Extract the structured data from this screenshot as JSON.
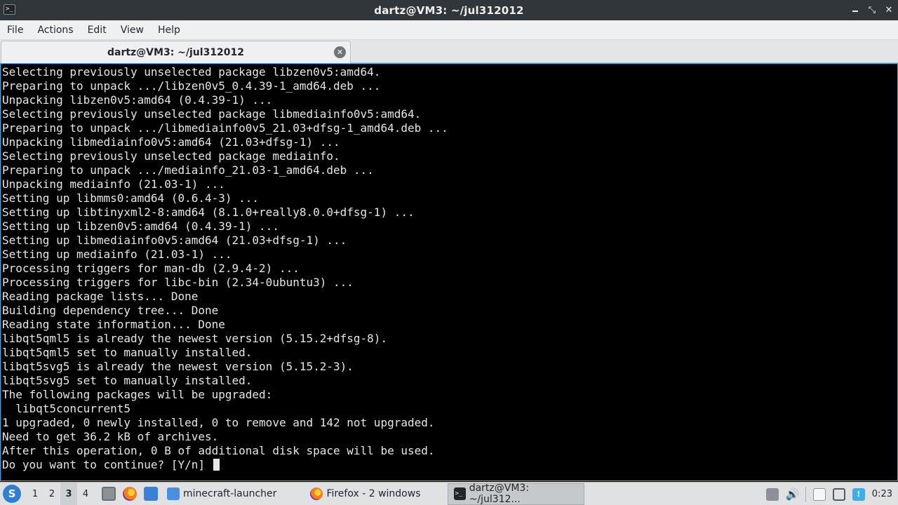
{
  "window": {
    "title": "dartz@VM3: ~/jul312012",
    "controls": [
      "minimize",
      "restore",
      "close"
    ]
  },
  "menu": {
    "items": [
      "File",
      "Actions",
      "Edit",
      "View",
      "Help"
    ]
  },
  "tab": {
    "label": "dartz@VM3: ~/jul312012"
  },
  "terminal": {
    "lines": [
      "Selecting previously unselected package libzen0v5:amd64.",
      "Preparing to unpack .../libzen0v5_0.4.39-1_amd64.deb ...",
      "Unpacking libzen0v5:amd64 (0.4.39-1) ...",
      "Selecting previously unselected package libmediainfo0v5:amd64.",
      "Preparing to unpack .../libmediainfo0v5_21.03+dfsg-1_amd64.deb ...",
      "Unpacking libmediainfo0v5:amd64 (21.03+dfsg-1) ...",
      "Selecting previously unselected package mediainfo.",
      "Preparing to unpack .../mediainfo_21.03-1_amd64.deb ...",
      "Unpacking mediainfo (21.03-1) ...",
      "Setting up libmms0:amd64 (0.6.4-3) ...",
      "Setting up libtinyxml2-8:amd64 (8.1.0+really8.0.0+dfsg-1) ...",
      "Setting up libzen0v5:amd64 (0.4.39-1) ...",
      "Setting up libmediainfo0v5:amd64 (21.03+dfsg-1) ...",
      "Setting up mediainfo (21.03-1) ...",
      "Processing triggers for man-db (2.9.4-2) ...",
      "Processing triggers for libc-bin (2.34-0ubuntu3) ...",
      "Reading package lists... Done",
      "Building dependency tree... Done",
      "Reading state information... Done",
      "libqt5qml5 is already the newest version (5.15.2+dfsg-8).",
      "libqt5qml5 set to manually installed.",
      "libqt5svg5 is already the newest version (5.15.2-3).",
      "libqt5svg5 set to manually installed.",
      "The following packages will be upgraded:",
      "  libqt5concurrent5",
      "1 upgraded, 0 newly installed, 0 to remove and 142 not upgraded.",
      "Need to get 36.2 kB of archives.",
      "After this operation, 0 B of additional disk space will be used.",
      "Do you want to continue? [Y/n] "
    ]
  },
  "taskbar": {
    "workspaces": [
      "1",
      "2",
      "3",
      "4"
    ],
    "active_workspace": "3",
    "tasks": [
      {
        "label": "minecraft-launcher",
        "icon": "folder-icon"
      },
      {
        "label": "Firefox - 2 windows",
        "icon": "firefox-icon"
      },
      {
        "label": "dartz@VM3: ~/jul312...",
        "icon": "terminal-icon"
      }
    ],
    "clock": "0:23"
  },
  "colors": {
    "titlebar": "#31363b",
    "terminal_bg": "#000000",
    "terminal_fg": "#e6e6e6",
    "accent": "#3daee9",
    "taskbar": "#dfe1e3"
  }
}
